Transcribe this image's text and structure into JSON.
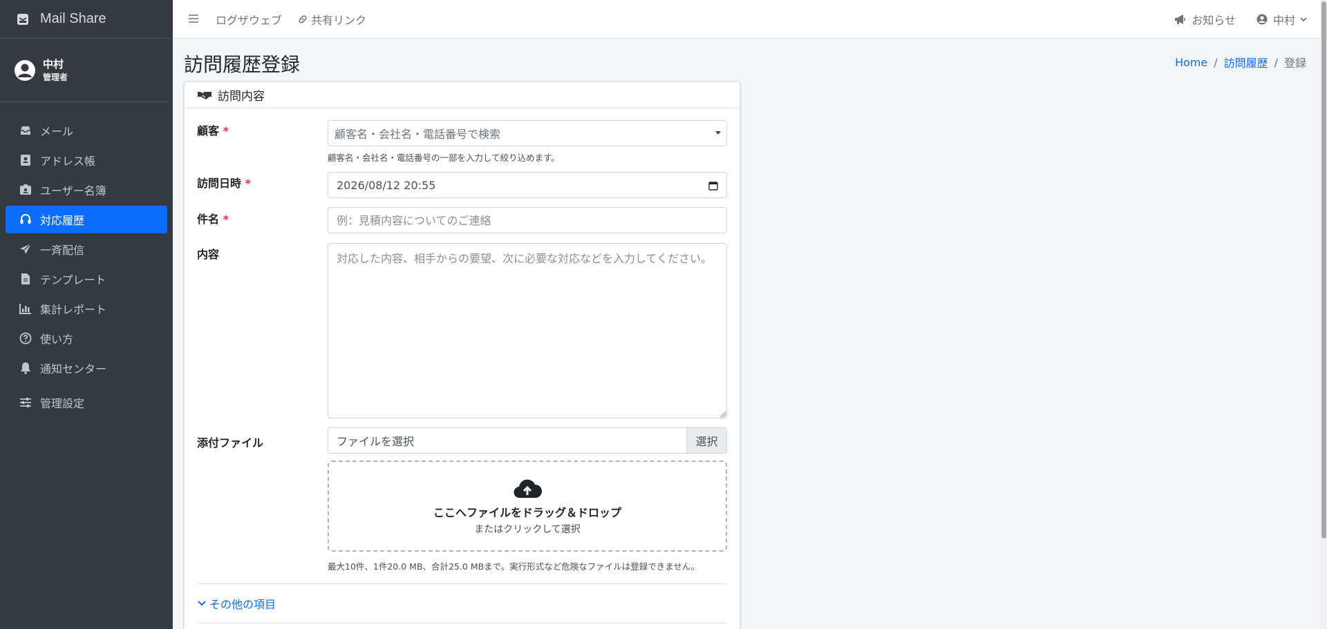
{
  "brand": {
    "name": "Mail Share"
  },
  "user": {
    "name": "中村",
    "role": "管理者"
  },
  "sidebar": {
    "items": [
      {
        "label": "メール",
        "icon": "inbox-icon"
      },
      {
        "label": "アドレス帳",
        "icon": "address-book-icon"
      },
      {
        "label": "ユーザー名簿",
        "icon": "id-badge-icon"
      },
      {
        "label": "対応履歴",
        "icon": "headset-icon",
        "active": true
      },
      {
        "label": "一斉配信",
        "icon": "paper-plane-icon"
      },
      {
        "label": "テンプレート",
        "icon": "file-icon"
      },
      {
        "label": "集計レポート",
        "icon": "bar-chart-icon"
      },
      {
        "label": "使い方",
        "icon": "question-circle-icon"
      },
      {
        "label": "通知センター",
        "icon": "bell-icon"
      },
      {
        "label": "管理設定",
        "icon": "sliders-icon"
      }
    ]
  },
  "topbar": {
    "links": [
      "ログザウェブ",
      "共有リンク"
    ],
    "notifications": "お知らせ",
    "user_menu": "中村"
  },
  "page": {
    "title": "訪問履歴登録",
    "breadcrumb": {
      "home": "Home",
      "parent": "訪問履歴",
      "current": "登録"
    }
  },
  "card": {
    "header": "訪問内容",
    "customer": {
      "label": "顧客",
      "required_mark": "*",
      "placeholder": "顧客名・会社名・電話番号で検索",
      "help": "顧客名・会社名・電話番号の一部を入力して絞り込めます。"
    },
    "visit_datetime": {
      "label": "訪問日時",
      "required_mark": "*",
      "value": "2026/08/12 20:55"
    },
    "subject": {
      "label": "件名",
      "required_mark": "*",
      "placeholder": "例：見積内容についてのご連絡"
    },
    "content": {
      "label": "内容",
      "placeholder": "対応した内容、相手からの要望、次に必要な対応などを入力してください。"
    },
    "attachment": {
      "label": "添付ファイル",
      "file_placeholder": "ファイルを選択",
      "button": "選択",
      "drop_title": "ここへファイルをドラッグ＆ドロップ",
      "drop_sub": "またはクリックして選択",
      "help": "最大10件、1件20.0 MB、合計25.0 MBまで。実行形式など危険なファイルは登録できません。"
    },
    "more": "その他の項目"
  },
  "colors": {
    "sidebar_bg": "#343a40",
    "accent": "#0d6efd",
    "required": "#dc3545"
  }
}
